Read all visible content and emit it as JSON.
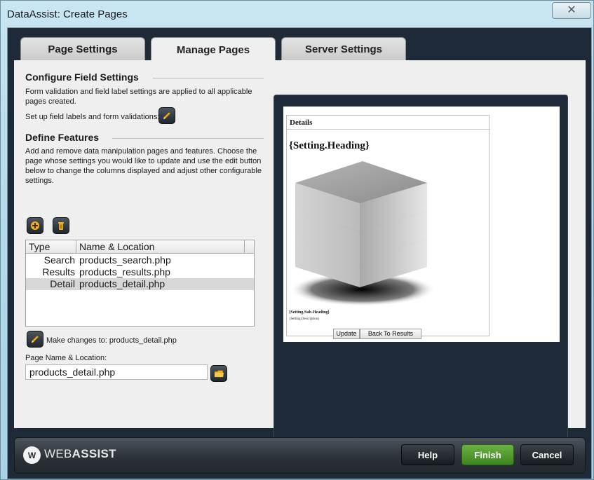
{
  "window": {
    "title": "DataAssist: Create Pages",
    "close_glyph": "✕"
  },
  "tabs": [
    {
      "label": "Page Settings",
      "active": false
    },
    {
      "label": "Manage Pages",
      "active": true
    },
    {
      "label": "Server Settings",
      "active": false
    }
  ],
  "configure": {
    "title": "Configure Field Settings",
    "description": "Form validation and field label settings are applied to all applicable pages created.",
    "setup_label": "Set up field labels and form validations:"
  },
  "features": {
    "title": "Define Features",
    "description": "Add and remove data manipulation pages and features. Choose the page whose settings you would like to update and use the edit button below to change the columns displayed and adjust other configurable settings."
  },
  "table": {
    "columns": [
      "Type",
      "Name & Location"
    ],
    "rows": [
      {
        "type": "Search",
        "name": "products_search.php",
        "selected": false
      },
      {
        "type": "Results",
        "name": "products_results.php",
        "selected": false
      },
      {
        "type": "Detail",
        "name": "products_detail.php",
        "selected": true
      }
    ]
  },
  "edit": {
    "label": "Make changes to: products_detail.php"
  },
  "page_name": {
    "label": "Page Name & Location:",
    "value": "products_detail.php"
  },
  "preview": {
    "legend": "Details",
    "heading": "{Setting.Heading}",
    "subheading": "{Setting.Sub-Heading}",
    "description": "{Setting.Description}",
    "buttons": [
      "Update",
      "Back To Results"
    ]
  },
  "footer": {
    "logo_mark": "W",
    "logo_text_light": "WEB",
    "logo_text_bold": "ASSIST",
    "buttons": {
      "help": "Help",
      "finish": "Finish",
      "cancel": "Cancel"
    }
  },
  "colors": {
    "accent": "#f2b01e",
    "finish": "#4f9a2e",
    "frame": "#1e2a38"
  },
  "icons": {
    "add": "plus-icon",
    "delete": "trash-icon",
    "edit": "pencil-icon",
    "folder": "folder-icon"
  }
}
